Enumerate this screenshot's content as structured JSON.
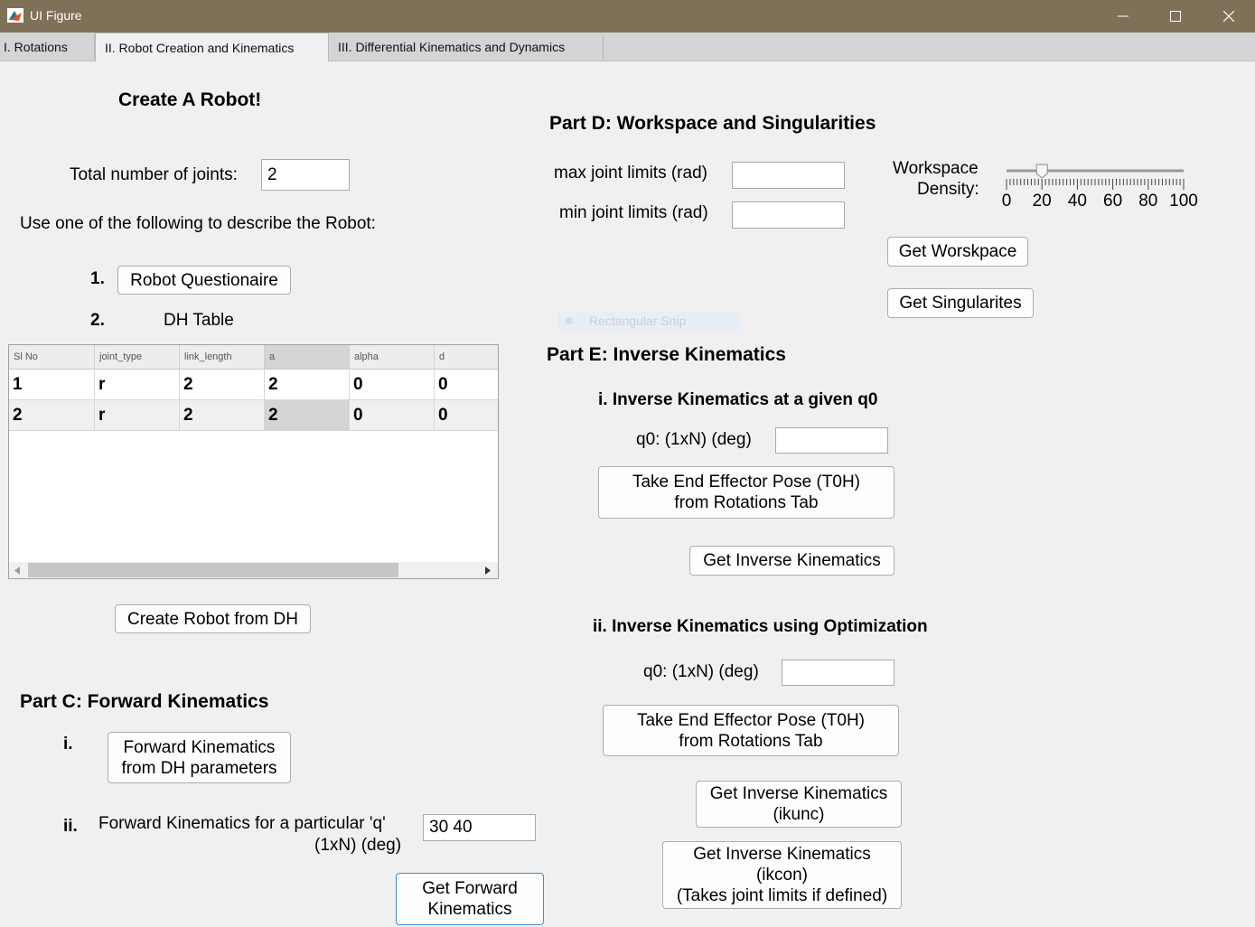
{
  "window": {
    "title": "UI Figure",
    "minimize_icon": "minimize-icon",
    "maximize_icon": "maximize-icon",
    "close_icon": "close-icon",
    "title_bar_color": "#7f7158"
  },
  "tabs": [
    {
      "label": "I. Rotations"
    },
    {
      "label": "II. Robot Creation and Kinematics"
    },
    {
      "label": "III. Differential Kinematics and Dynamics"
    }
  ],
  "create": {
    "heading": "Create A Robot!",
    "joints_label": "Total number of joints:",
    "joints_value": "2",
    "describe_label": "Use one of the following to describe the Robot:",
    "num1": "1.",
    "questionnaire_button": "Robot Questionaire",
    "num2": "2.",
    "dh_label": "DH Table",
    "table": {
      "headers": [
        "Sl No",
        "joint_type",
        "link_length",
        "a",
        "alpha",
        "d"
      ],
      "rows": [
        [
          "1",
          "r",
          "2",
          "2",
          "0",
          "0"
        ],
        [
          "2",
          "r",
          "2",
          "2",
          "0",
          "0"
        ]
      ],
      "highlight_color": "#d4d4d4"
    },
    "create_button": "Create Robot from DH"
  },
  "partC": {
    "heading": "Part C: Forward Kinematics",
    "i_label": "i.",
    "fk_dh_button": "Forward Kinematics\nfrom DH parameters",
    "ii_label": "ii.",
    "fk_q_line1": "Forward Kinematics for a particular 'q'",
    "fk_q_line2": "(1xN) (deg)",
    "q_value": "30 40",
    "get_fk_button": "Get Forward\nKinematics"
  },
  "partD": {
    "heading": "Part D: Workspace and Singularities",
    "max_label": "max joint limits (rad)",
    "max_value": "",
    "min_label": "min joint limits (rad)",
    "min_value": "",
    "density_label_1": "Workspace",
    "density_label_2": "Density:",
    "slider_value": 20,
    "slider_min": 0,
    "slider_max": 100,
    "slider_ticks": [
      "0",
      "20",
      "40",
      "60",
      "80",
      "100"
    ],
    "workspace_button": "Get Worskpace",
    "singularities_button": "Get Singularites"
  },
  "overlay": {
    "snip_label": "Rectangular Snip"
  },
  "partE": {
    "heading": "Part E: Inverse Kinematics",
    "i_heading": "i. Inverse Kinematics at a given q0",
    "i_q0_label": "q0: (1xN) (deg)",
    "i_q0_value": "",
    "i_take_button": "Take End Effector Pose (T0H)\nfrom Rotations Tab",
    "i_get_button": "Get Inverse Kinematics",
    "ii_heading": "ii. Inverse Kinematics using Optimization",
    "ii_q0_label": "q0: (1xN) (deg)",
    "ii_q0_value": "",
    "ii_take_button": "Take End Effector Pose (T0H)\nfrom Rotations Tab",
    "ikunc_button": "Get Inverse Kinematics\n(ikunc)",
    "ikcon_button": "Get Inverse Kinematics\n(ikcon)\n(Takes joint limits if defined)"
  }
}
